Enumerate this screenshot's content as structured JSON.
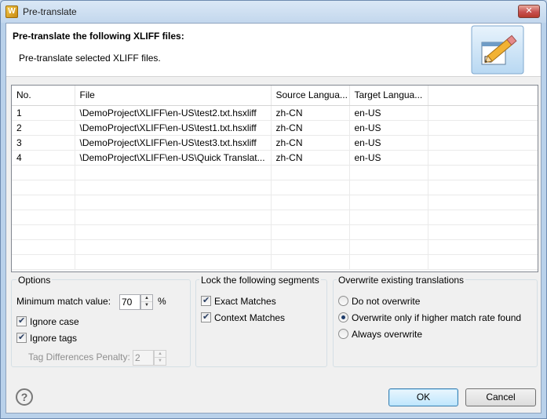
{
  "window": {
    "title": "Pre-translate",
    "close_glyph": "✕",
    "app_icon_glyph": "W"
  },
  "banner": {
    "title": "Pre-translate the following XLIFF files:",
    "description": "Pre-translate selected XLIFF files.",
    "icon": "edit-document-pencil-icon"
  },
  "table": {
    "columns": [
      "No.",
      "File",
      "Source Langua...",
      "Target Langua..."
    ],
    "rows": [
      [
        "1",
        "\\DemoProject\\XLIFF\\en-US\\test2.txt.hsxliff",
        "zh-CN",
        "en-US"
      ],
      [
        "2",
        "\\DemoProject\\XLIFF\\en-US\\test1.txt.hsxliff",
        "zh-CN",
        "en-US"
      ],
      [
        "3",
        "\\DemoProject\\XLIFF\\en-US\\test3.txt.hsxliff",
        "zh-CN",
        "en-US"
      ],
      [
        "4",
        "\\DemoProject\\XLIFF\\en-US\\Quick Translat...",
        "zh-CN",
        "en-US"
      ]
    ]
  },
  "options": {
    "title": "Options",
    "min_match_label": "Minimum match value:",
    "min_match_value": "70",
    "percent": "%",
    "ignore_case": {
      "label": "Ignore case",
      "checked": true
    },
    "ignore_tags": {
      "label": "Ignore tags",
      "checked": true
    },
    "tag_penalty_label": "Tag Differences Penalty:",
    "tag_penalty_value": "2"
  },
  "lock": {
    "title": "Lock the following segments",
    "exact": {
      "label": "Exact Matches",
      "checked": true
    },
    "context": {
      "label": "Context Matches",
      "checked": true
    }
  },
  "overwrite": {
    "title": "Overwrite existing translations",
    "options": [
      {
        "label": "Do not overwrite",
        "selected": false
      },
      {
        "label": "Overwrite only if higher match rate found",
        "selected": true
      },
      {
        "label": "Always overwrite",
        "selected": false
      }
    ]
  },
  "footer": {
    "help_glyph": "?",
    "ok_label": "OK",
    "cancel_label": "Cancel"
  }
}
